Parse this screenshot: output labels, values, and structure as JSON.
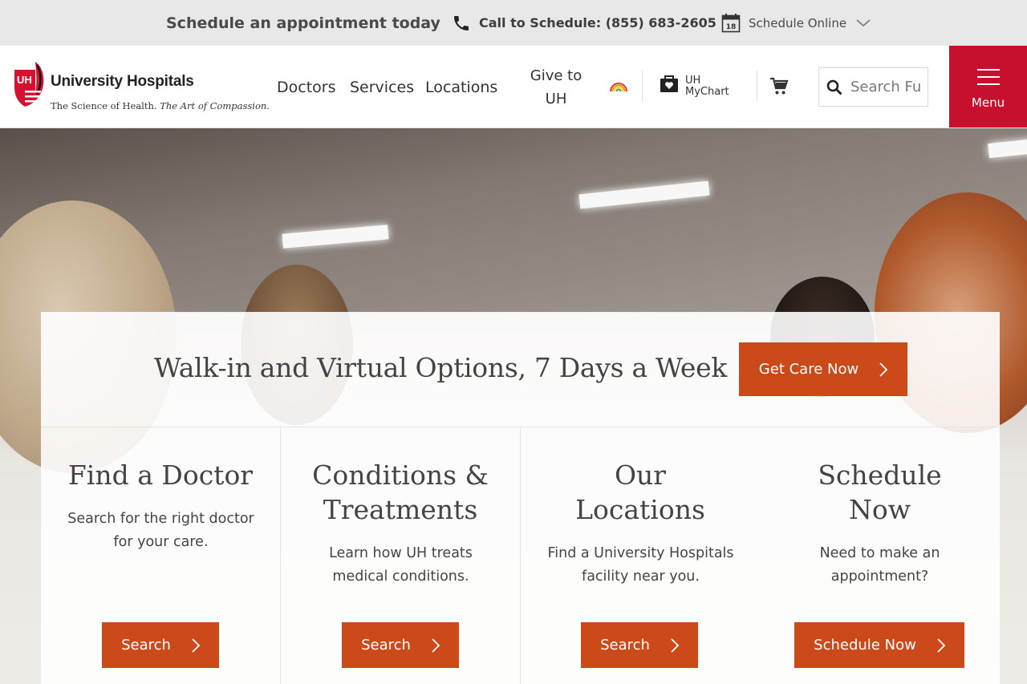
{
  "topbar": {
    "appointment_text": "Schedule an appointment today",
    "call_text": "Call to Schedule: (855) 683-2605",
    "calendar_day": "18",
    "schedule_online": "Schedule Online"
  },
  "logo": {
    "mark": "UH",
    "name": "University Hospitals",
    "tagline_plain": "The Science of Health.",
    "tagline_italic": "The Art of Compassion."
  },
  "nav": {
    "doctors": "Doctors",
    "services": "Services",
    "locations": "Locations",
    "give_line1": "Give to",
    "give_line2": "UH"
  },
  "mychart": {
    "line1": "UH",
    "line2": "MyChart"
  },
  "search": {
    "placeholder": "Search Fu"
  },
  "menu": {
    "label": "Menu"
  },
  "walkin": {
    "headline": "Walk-in and Virtual Options, 7 Days a Week",
    "button": "Get Care Now"
  },
  "cards": [
    {
      "title_line1": "Find a Doctor",
      "title_line2": "",
      "description": "Search for the right doctor for your care.",
      "button": "Search"
    },
    {
      "title_line1": "Conditions &",
      "title_line2": "Treatments",
      "description": "Learn how UH treats medical conditions.",
      "button": "Search"
    },
    {
      "title_line1": "Our",
      "title_line2": "Locations",
      "description": "Find a University Hospitals facility near you.",
      "button": "Search"
    },
    {
      "title_line1": "Schedule",
      "title_line2": "Now",
      "description": "Need to make an appointment?",
      "button": "Schedule Now"
    }
  ],
  "colors": {
    "brand_red": "#c8102e",
    "button_orange": "#cc4a1a",
    "topbar_gray": "#e8e8e8"
  },
  "icons": [
    "phone-icon",
    "calendar-icon",
    "chevron-down-icon",
    "uh-logo-mark",
    "rainbow-icon",
    "mychart-icon",
    "cart-icon",
    "search-icon",
    "hamburger-icon",
    "chevron-right-icon"
  ]
}
